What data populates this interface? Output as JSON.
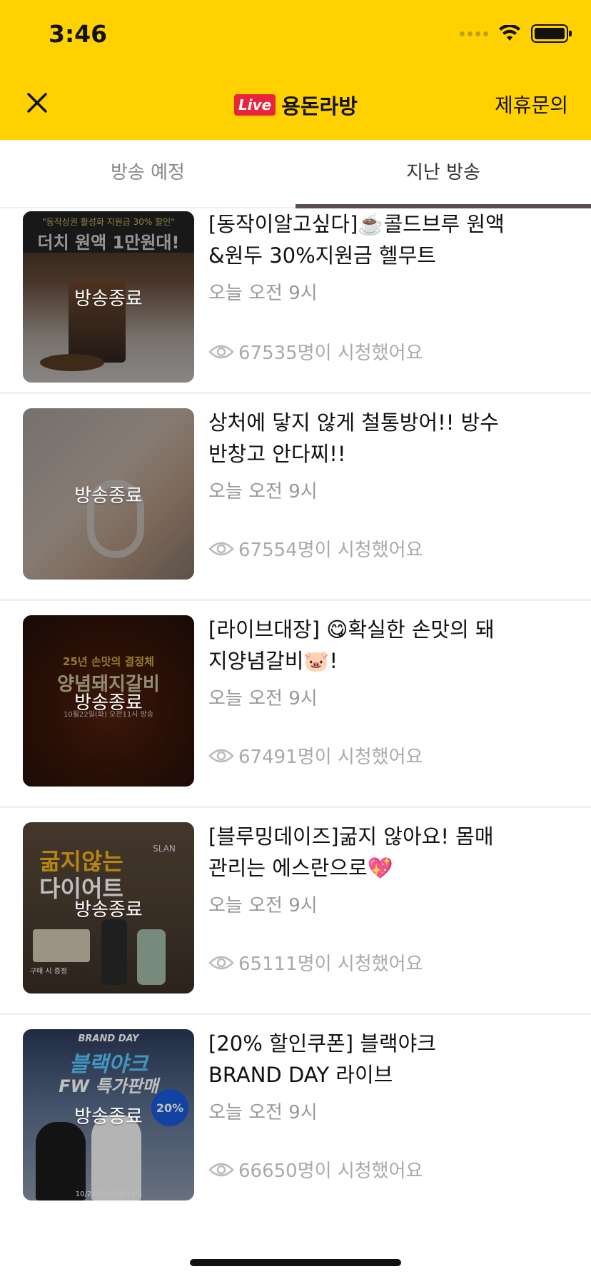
{
  "status": {
    "time": "3:46"
  },
  "header": {
    "live_badge": "Live",
    "title": "용돈라방",
    "partner_link": "제휴문의"
  },
  "tabs": [
    {
      "label": "방송 예정",
      "active": false
    },
    {
      "label": "지난 방송",
      "active": true
    }
  ],
  "items": [
    {
      "title": "[동작이알고싶다]☕️콜드브루 원액&원두 30%지원금 헬무트",
      "time": "오늘 오전 9시",
      "views": "67535명이 시청했어요",
      "badge": "방송종료",
      "thumb_caption": "\"동작상권 활성화 지원금 30% 할인\"",
      "thumb_headline": "더치 원액 1만원대!"
    },
    {
      "title": "상처에 닿지 않게 철통방어!! 방수 반창고 안다찌!!",
      "time": "오늘 오전 9시",
      "views": "67554명이 시청했어요",
      "badge": "방송종료"
    },
    {
      "title": "[라이브대장] 😋확실한 손맛의 돼지양념갈비🐷!",
      "time": "오늘 오전 9시",
      "views": "67491명이 시청했어요",
      "badge": "방송종료",
      "thumb_caption": "25년 손맛의 결정체",
      "thumb_headline": "양념돼지갈비",
      "thumb_date": "10월22일(화) 오전11시 방송"
    },
    {
      "title": "[블루밍데이즈]굶지 않아요! 몸매 관리는 에스란으로💖",
      "time": "오늘 오전 9시",
      "views": "65111명이 시청했어요",
      "badge": "방송종료",
      "thumb_caption": "굶지않는",
      "thumb_headline": "다이어트",
      "thumb_brand": "SLAN",
      "thumb_gift": "구매 시 증정"
    },
    {
      "title": "[20% 할인쿠폰] 블랙야크 BRAND DAY 라이브",
      "time": "오늘 오전 9시",
      "views": "66650명이 시청했어요",
      "badge": "방송종료",
      "thumb_caption": "BRAND DAY",
      "thumb_headline": "블랙야크",
      "thumb_sub": "FW 특가판매",
      "thumb_coupon": "20%",
      "thumb_date": "10/22(화) 오전 11시"
    }
  ],
  "colors": {
    "header_bg": "#FFD100",
    "live_badge": "#E8253A",
    "tab_indicator": "#5a4e4e"
  }
}
